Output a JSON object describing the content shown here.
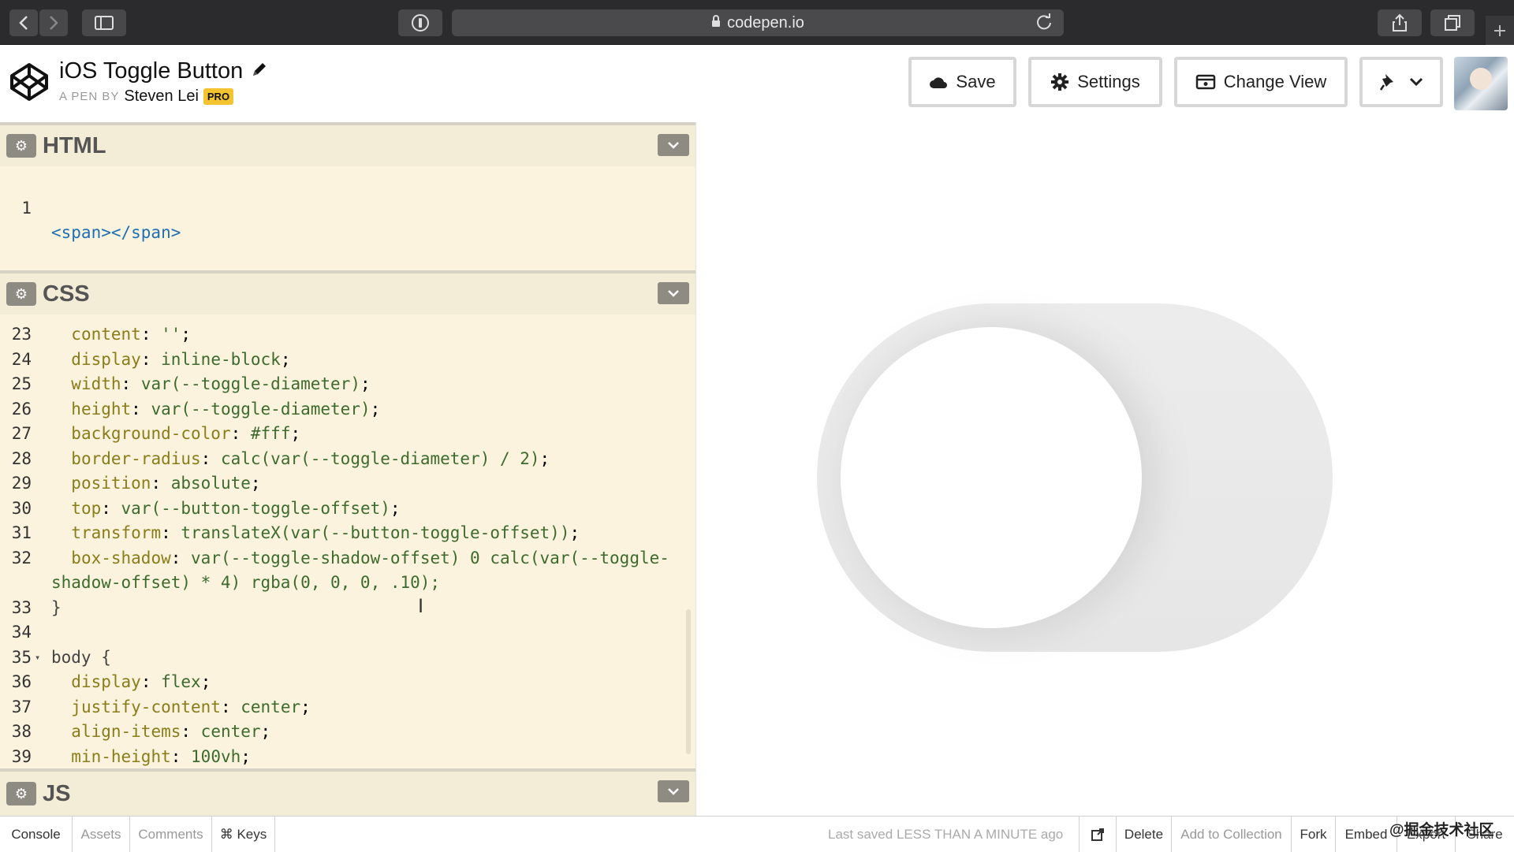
{
  "browser": {
    "url": "codepen.io",
    "back_icon": "chevron-left-icon",
    "forward_icon": "chevron-right-icon"
  },
  "pen": {
    "title": "iOS Toggle Button",
    "by_label": "A PEN BY",
    "author": "Steven Lei",
    "badge": "PRO"
  },
  "toolbar": {
    "save_label": "Save",
    "settings_label": "Settings",
    "change_view_label": "Change View"
  },
  "panels": {
    "html": "HTML",
    "css": "CSS",
    "js": "JS"
  },
  "html_code": [
    {
      "n": "1",
      "t": "<span></span>"
    }
  ],
  "css_code": [
    {
      "n": "23",
      "prop": "content",
      "val": "''"
    },
    {
      "n": "24",
      "prop": "display",
      "val": "inline-block"
    },
    {
      "n": "25",
      "prop": "width",
      "val": "var(--toggle-diameter)"
    },
    {
      "n": "26",
      "prop": "height",
      "val": "var(--toggle-diameter)"
    },
    {
      "n": "27",
      "prop": "background-color",
      "val": "#fff"
    },
    {
      "n": "28",
      "prop": "border-radius",
      "val": "calc(var(--toggle-diameter) / 2)"
    },
    {
      "n": "29",
      "prop": "position",
      "val": "absolute"
    },
    {
      "n": "30",
      "prop": "top",
      "val": "var(--button-toggle-offset)"
    },
    {
      "n": "31",
      "prop": "transform",
      "val": "translateX(var(--button-toggle-offset))"
    },
    {
      "n": "32",
      "prop": "box-shadow",
      "val": "var(--toggle-shadow-offset) 0 calc(var(--toggle-",
      "cont": "shadow-offset) * 4) rgba(0, 0, 0, .10);"
    },
    {
      "n": "33",
      "raw": "}"
    },
    {
      "n": "34",
      "raw": ""
    },
    {
      "n": "35",
      "raw": "body {",
      "fold": true
    },
    {
      "n": "36",
      "prop": "display",
      "val": "flex"
    },
    {
      "n": "37",
      "prop": "justify-content",
      "val": "center"
    },
    {
      "n": "38",
      "prop": "align-items",
      "val": "center"
    },
    {
      "n": "39",
      "prop": "min-height",
      "val": "100vh"
    }
  ],
  "bottom": {
    "console": "Console",
    "assets": "Assets",
    "comments": "Comments",
    "keys": "⌘ Keys",
    "saved": "Last saved LESS THAN A MINUTE ago",
    "delete": "Delete",
    "add_to_collection": "Add to Collection",
    "fork": "Fork",
    "embed": "Embed",
    "export": "Export",
    "share": "Share"
  },
  "watermark": "@掘金技术社区",
  "colors": {
    "editor_bg": "#fbf3dd",
    "toggle_track": "#e8e8e8",
    "pro_badge": "#f4c430"
  }
}
